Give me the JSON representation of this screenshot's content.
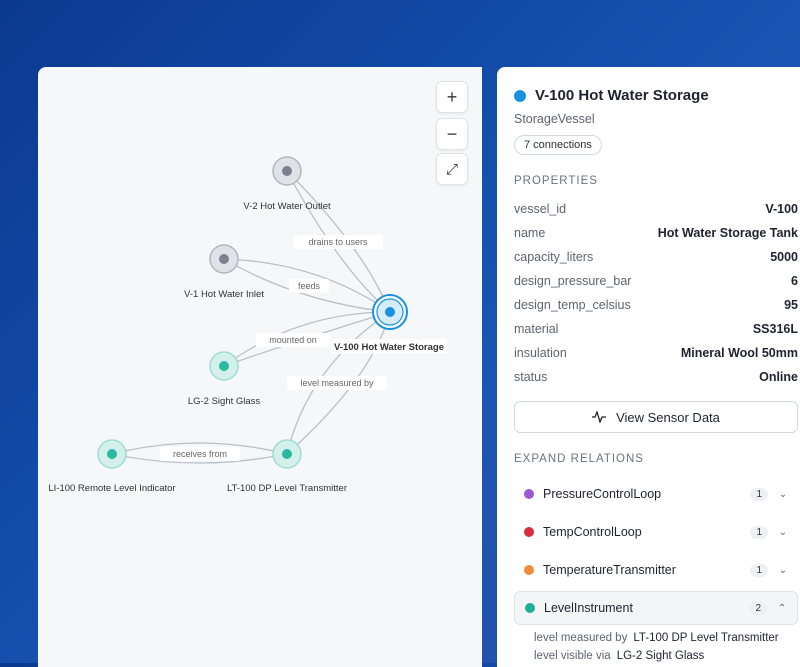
{
  "graph": {
    "nodes": [
      {
        "id": "v2",
        "label": "V-2 Hot Water Outlet",
        "kind": "gray"
      },
      {
        "id": "v1",
        "label": "V-1 Hot Water Inlet",
        "kind": "gray"
      },
      {
        "id": "v100",
        "label": "V-100 Hot Water Storage",
        "kind": "blue"
      },
      {
        "id": "lg2",
        "label": "LG-2 Sight Glass",
        "kind": "teal"
      },
      {
        "id": "li100",
        "label": "LI-100 Remote Level Indicator",
        "kind": "teal"
      },
      {
        "id": "lt100",
        "label": "LT-100 DP Level Transmitter",
        "kind": "teal"
      }
    ],
    "edge_labels": {
      "drains": "drains to users",
      "feeds": "feeds",
      "mounted": "mounted on",
      "measures": "level measured by",
      "receives": "receives from"
    },
    "zoom_in": "+",
    "zoom_out": "−",
    "fit": "⤢"
  },
  "details": {
    "title": "V-100 Hot Water Storage",
    "subtitle": "StorageVessel",
    "connections": "7 connections",
    "properties_heading": "PROPERTIES",
    "properties": [
      {
        "key": "vessel_id",
        "value": "V-100"
      },
      {
        "key": "name",
        "value": "Hot Water Storage Tank"
      },
      {
        "key": "capacity_liters",
        "value": "5000"
      },
      {
        "key": "design_pressure_bar",
        "value": "6"
      },
      {
        "key": "design_temp_celsius",
        "value": "95"
      },
      {
        "key": "material",
        "value": "SS316L"
      },
      {
        "key": "insulation",
        "value": "Mineral Wool 50mm"
      },
      {
        "key": "status",
        "value": "Online"
      }
    ],
    "sensor_button": "View Sensor Data",
    "relations_heading": "EXPAND RELATIONS",
    "relations": [
      {
        "label": "PressureControlLoop",
        "count": "1",
        "color": "#9b59d6",
        "chevron": "⌄"
      },
      {
        "label": "TempControlLoop",
        "count": "1",
        "color": "#d62e3b",
        "chevron": "⌄"
      },
      {
        "label": "TemperatureTransmitter",
        "count": "1",
        "color": "#f28a3c",
        "chevron": "⌄"
      },
      {
        "label": "LevelInstrument",
        "count": "2",
        "color": "#1fae98",
        "chevron": "⌃"
      }
    ],
    "relation_items": [
      {
        "relation": "level measured by",
        "target": "LT-100 DP Level Transmitter"
      },
      {
        "relation": "level visible via",
        "target": "LG-2 Sight Glass"
      }
    ]
  },
  "colors": {
    "accent_blue": "#1a91e0",
    "gray_node": "#7b828d",
    "teal_node": "#2bb8a3"
  }
}
